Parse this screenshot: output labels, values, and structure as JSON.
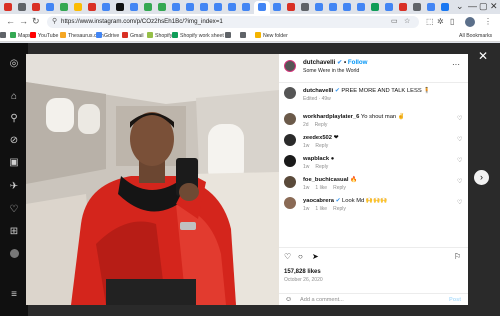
{
  "browser": {
    "tab_colors": [
      "#d93025",
      "#5f6368",
      "#d93025",
      "#4285f4",
      "#34a853",
      "#fbbc04",
      "#d93025",
      "#4285f4",
      "#111111",
      "#4285f4",
      "#34a853",
      "#34a853",
      "#4285f4",
      "#4285f4",
      "#4285f4",
      "#4285f4",
      "#4285f4",
      "#4285f4",
      "#4285f4",
      "#4285f4",
      "#d93025",
      "#5f6368",
      "#4285f4",
      "#4285f4",
      "#4285f4",
      "#4285f4",
      "#0f9d58",
      "#4285f4",
      "#d93025",
      "#5f6368",
      "#4285f4",
      "#1877f2"
    ],
    "url": "https://www.instagram.com/p/COz2hsEh1Bc/?img_index=1",
    "bookmarks": [
      {
        "label": "Maps",
        "color": "#34a853"
      },
      {
        "label": "YouTube",
        "color": "#ff0000"
      },
      {
        "label": "Thesaurus.com",
        "color": "#f5a623"
      },
      {
        "label": "Gdrive",
        "color": "#4285f4"
      },
      {
        "label": "Gmail",
        "color": "#d93025"
      },
      {
        "label": "Shopify",
        "color": "#95bf47"
      },
      {
        "label": "Shopify work sheet",
        "color": "#0f9d58"
      },
      {
        "label": "",
        "color": "#5f6368"
      },
      {
        "label": "",
        "color": "#5f6368"
      },
      {
        "label": "New folder",
        "color": "#f4b400"
      }
    ],
    "all_bookmarks_label": "All Bookmarks"
  },
  "post": {
    "username": "dutchavelli",
    "follow_label": "Follow",
    "location": "Some Were in the World",
    "caption_user": "dutchavelli",
    "caption_text": "PREE MORE AND TALK LESS",
    "caption_meta": "Edited · 49w",
    "likes": "157,828 likes",
    "date": "October 26, 2020",
    "add_comment_placeholder": "Add a comment...",
    "post_label": "Post"
  },
  "comments": [
    {
      "user": "workhardplaylater_6",
      "text": "Yo shout man ✌",
      "age": "2d",
      "likes": "",
      "reply": "Reply",
      "avatar": "#6b5a4a"
    },
    {
      "user": "zeedex502",
      "text": "❤",
      "age": "1w",
      "likes": "",
      "reply": "Reply",
      "avatar": "#2b2b2b"
    },
    {
      "user": "wapblack",
      "text": "●",
      "age": "1w",
      "likes": "",
      "reply": "Reply",
      "avatar": "#1a1a1a"
    },
    {
      "user": "foe_buchicasual",
      "text": "🔥",
      "age": "1w",
      "likes": "1 like",
      "reply": "Reply",
      "avatar": "#5a4a3a"
    },
    {
      "user": "yaocabrera",
      "text": "Look Md 🙌🙌🙌",
      "age": "1w",
      "likes": "1 like",
      "reply": "Reply",
      "avatar": "#8a6a55"
    }
  ],
  "colors": {
    "accent": "#0095f6",
    "verified": "#3897f0",
    "jacket": "#d4251c"
  }
}
